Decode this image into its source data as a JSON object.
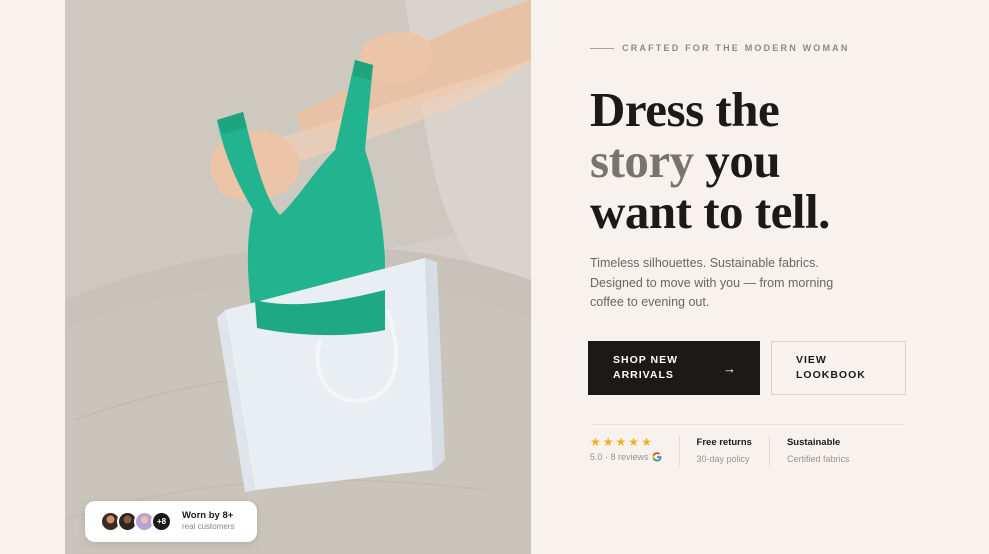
{
  "social_proof": {
    "title": "Worn by 8+",
    "subtitle": "real customers",
    "more_count": "+8"
  },
  "hero": {
    "eyebrow": "CRAFTED FOR THE MODERN WOMAN",
    "headline": {
      "line1": "Dress the",
      "accent": "story",
      "line2_rest": " you",
      "line3": "want to tell."
    },
    "description": "Timeless silhouettes. Sustainable fabrics. Designed to move with you — from morning coffee to evening out.",
    "primary_cta": "SHOP NEW\nARRIVALS",
    "primary_arrow": "→",
    "secondary_cta": "VIEW\nLOOKBOOK"
  },
  "trust": {
    "rating_stars": 5,
    "rating_text": "5.0 · 8 reviews",
    "items": [
      {
        "title": "Free returns",
        "subtitle": "30-day policy"
      },
      {
        "title": "Sustainable",
        "subtitle": "Certified fabrics"
      }
    ]
  },
  "colors": {
    "background": "#f7f2ee",
    "ink": "#1c1a18",
    "accent_text": "#7c746c",
    "star": "#f2b01e",
    "garment": "#22b48f"
  },
  "icons": {
    "arrow": "arrow-right-icon",
    "google": "google-icon",
    "star": "star-icon"
  }
}
